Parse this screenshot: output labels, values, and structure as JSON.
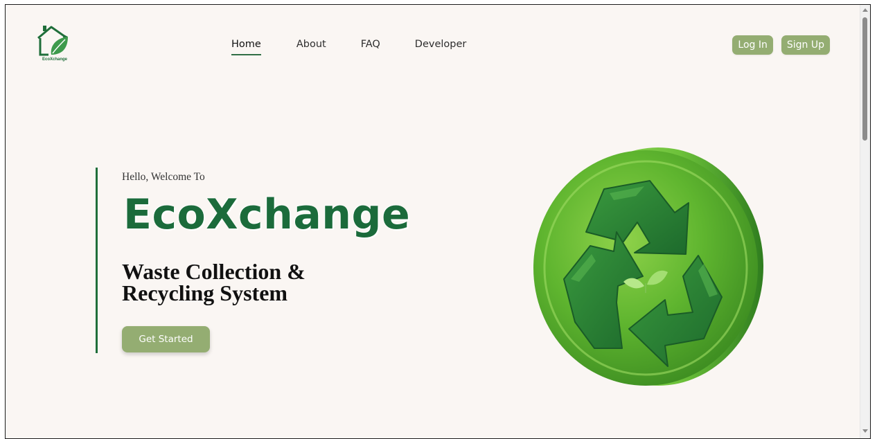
{
  "brand": {
    "logo_text": "EcoXchange",
    "name": "EcoXchange",
    "color": "#1b6b3b"
  },
  "nav": {
    "items": [
      {
        "label": "Home",
        "active": true
      },
      {
        "label": "About",
        "active": false
      },
      {
        "label": "FAQ",
        "active": false
      },
      {
        "label": "Developer",
        "active": false
      }
    ]
  },
  "auth": {
    "login_label": "Log In",
    "signup_label": "Sign Up",
    "button_color": "#94ad72"
  },
  "hero": {
    "greeting": "Hello, Welcome To",
    "title": "EcoXchange",
    "tagline_line1": "Waste Collection &",
    "tagline_line2": "Recycling System",
    "cta_label": "Get Started",
    "illustration_icon": "recycle-icon"
  },
  "colors": {
    "background": "#faf6f3",
    "accent": "#1f6e3a"
  }
}
